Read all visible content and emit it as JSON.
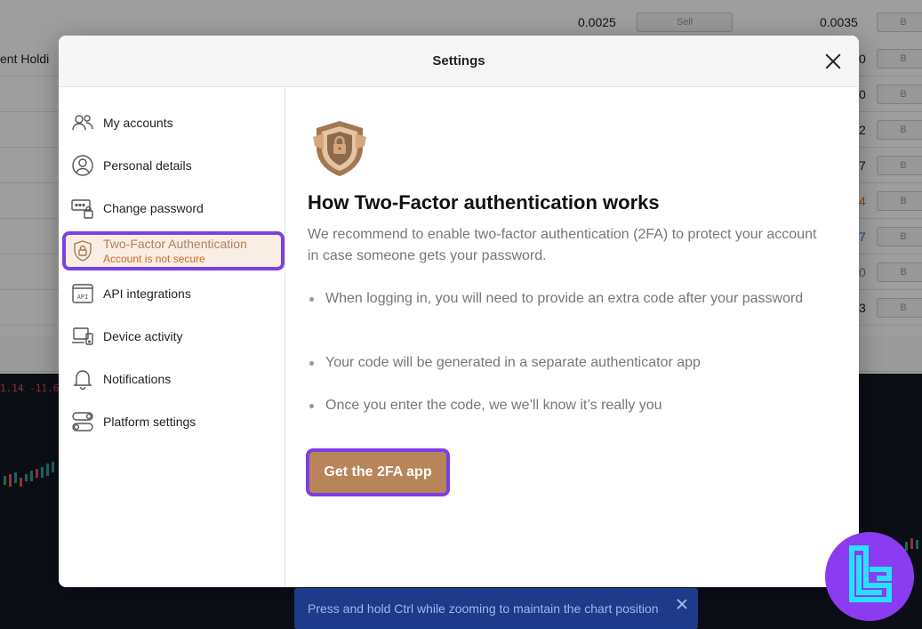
{
  "background": {
    "top_prices": [
      "0.0025",
      "0.0035"
    ],
    "sell_label": "Sell",
    "buy_label": "B",
    "holdings_label": "ent Holdi",
    "row_values": [
      "0",
      "0",
      "2",
      "7",
      "4",
      "7",
      "0",
      "3"
    ],
    "chart_readout": "1.14 -11.6"
  },
  "modal": {
    "title": "Settings",
    "sidebar": {
      "items": [
        {
          "label": "My accounts",
          "icon": "users-icon"
        },
        {
          "label": "Personal details",
          "icon": "user-circle-icon"
        },
        {
          "label": "Change password",
          "icon": "password-lock-icon"
        },
        {
          "label": "Two-Factor Authentication",
          "sublabel": "Account is not secure",
          "icon": "shield-lock-icon",
          "active": true
        },
        {
          "label": "API integrations",
          "icon": "api-icon"
        },
        {
          "label": "Device activity",
          "icon": "devices-icon"
        },
        {
          "label": "Notifications",
          "icon": "bell-icon"
        },
        {
          "label": "Platform settings",
          "icon": "toggles-icon"
        }
      ]
    },
    "content": {
      "title": "How Two-Factor authentication works",
      "intro": "We recommend to enable two-factor authentication (2FA) to protect your account in case someone gets your password.",
      "bullets": [
        "When logging in, you will need to provide an extra code after your password",
        "Your code will be generated in a separate authenticator app",
        "Once you enter the code, we we’ll know it’s really you"
      ],
      "cta_label": "Get the 2FA app"
    }
  },
  "toast": {
    "message": "Press and hold Ctrl while zooming to maintain the chart position"
  },
  "colors": {
    "accent_outline": "#7b3fe4",
    "cta_bg": "#b88559",
    "active_bg": "#f8eee4",
    "warning_text": "#d06a2a",
    "toast_bg": "#1e3a8a"
  }
}
